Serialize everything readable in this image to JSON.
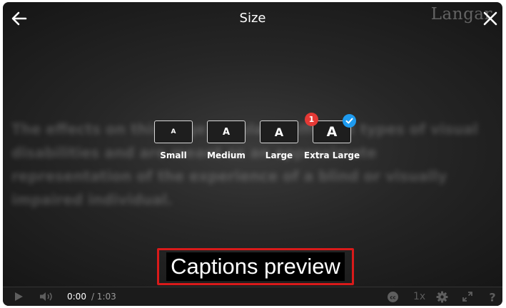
{
  "header": {
    "title": "Size",
    "back_icon": "arrow-left-icon",
    "close_icon": "close-icon"
  },
  "watermark": "Langar",
  "background_text": "The effects on this page simulate different types of visual disabilities and are meant as an approximate representation of the experience of a blind or visually impaired individual.",
  "size_options": [
    {
      "glyph": "A",
      "label": "Small"
    },
    {
      "glyph": "A",
      "label": "Medium"
    },
    {
      "glyph": "A",
      "label": "Large"
    },
    {
      "glyph": "A",
      "label": "Extra Large",
      "selected": true,
      "badge": "1"
    }
  ],
  "caption_preview": "Captions preview",
  "colors": {
    "accent_blue": "#1e9bf0",
    "badge_red": "#e53935",
    "highlight_red": "#d91a1a"
  },
  "controls": {
    "current_time": "0:00",
    "duration": "/ 1:03",
    "speed": "1x",
    "icons": [
      "play-icon",
      "volume-icon",
      "closed-captions-icon",
      "settings-gear-icon",
      "fullscreen-icon",
      "help-icon"
    ]
  }
}
